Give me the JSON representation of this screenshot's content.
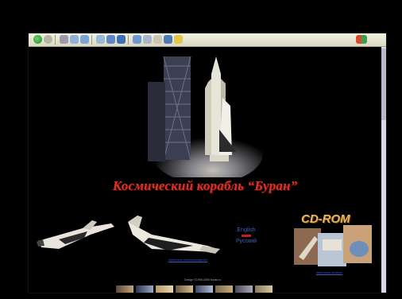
{
  "page": {
    "title": "Космический корабль “Буран”"
  },
  "links": {
    "ship_caption": "www.buran.ru/htm/molniya.htm",
    "lang_top": "English",
    "lang_bottom": "Русский",
    "cdrom_label": "CD-ROM",
    "cdrom_caption": "www.buran.ru/cdrom",
    "footer": "Design ©1998-2000 buran.ru"
  },
  "toolbar": {
    "icons": [
      "back-icon",
      "forward-icon",
      "stop-icon",
      "refresh-icon",
      "home-icon",
      "search-icon",
      "favorites-icon",
      "history-icon",
      "mail-icon",
      "print-icon",
      "edit-icon",
      "discuss-icon",
      "messenger-icon",
      "windows-logo-icon"
    ]
  },
  "colors": {
    "title": "#d8322a",
    "link": "#3c5cc8",
    "background": "#000000",
    "toolbar": "#e6e3cf"
  }
}
